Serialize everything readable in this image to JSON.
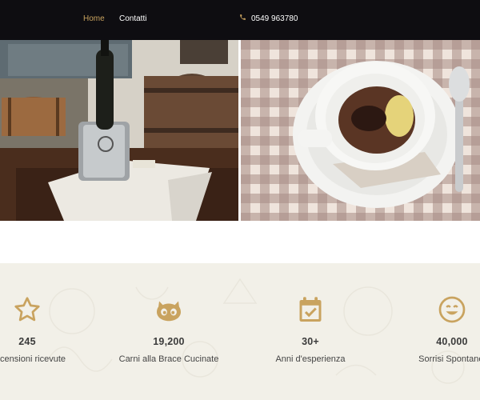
{
  "nav": {
    "home_label": "Home",
    "contatti_label": "Contatti",
    "phone_number": "0549 963780"
  },
  "icons": {
    "phone": "phone-icon",
    "star": "star-icon",
    "github": "github-icon",
    "calendar": "calendar-check-icon",
    "smile": "smile-icon"
  },
  "colors": {
    "topbar_bg": "#0e0d11",
    "accent_gold": "#c9a35f",
    "stats_bg": "#f2f0e8",
    "text_dark": "#3b3b3b"
  },
  "stats": [
    {
      "value": "245",
      "label": "Recensioni ricevute"
    },
    {
      "value": "19,200",
      "label": "Carni alla Brace Cucinate"
    },
    {
      "value": "30+",
      "label": "Anni d'esperienza"
    },
    {
      "value": "40,000",
      "label": "Sorrisi Spontanei"
    }
  ]
}
